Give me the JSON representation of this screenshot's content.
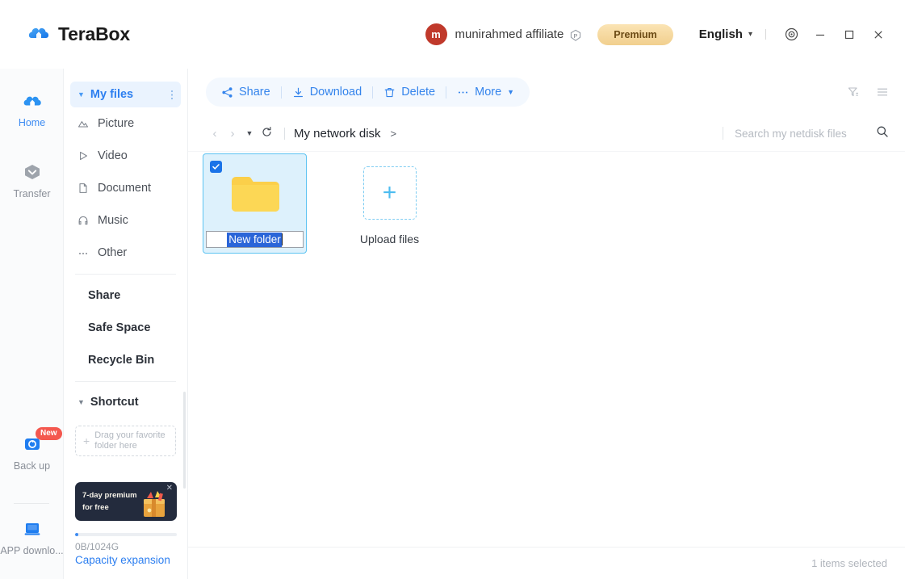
{
  "app": {
    "brand": "TeraBox",
    "brand_icon": "terabox-cloud-logo",
    "accent_color": "#2d7ff0",
    "selection_color": "#1a73e8",
    "folder_color": "#fbcf4a"
  },
  "titlebar": {
    "avatar_initial": "m",
    "user_name": "munirahmed affiliate",
    "user_badge_icon": "p-diamond-icon",
    "premium_label": "Premium",
    "language_label": "English",
    "language_caret_icon": "chevron-down-icon",
    "settings_icon": "target-settings-icon",
    "minimize_label": "—",
    "maximize_label": "☐",
    "close_label": "×"
  },
  "rail": {
    "items": [
      {
        "label": "Home",
        "icon": "cloud-icon",
        "active": true,
        "badge": ""
      },
      {
        "label": "Transfer",
        "icon": "transfer-hexagon-icon",
        "active": false,
        "badge": ""
      },
      {
        "label": "Back up",
        "icon": "backup-sync-icon",
        "active": false,
        "badge": "New"
      },
      {
        "label": "APP downlo...",
        "icon": "app-download-icon",
        "active": false,
        "badge": ""
      }
    ]
  },
  "sidebar": {
    "header": {
      "label": "My files",
      "expand_icon": "triangle-down-icon",
      "menu_icon": "kebab-menu-icon"
    },
    "items": [
      {
        "label": "Picture",
        "icon": "picture-icon",
        "bold": false
      },
      {
        "label": "Video",
        "icon": "video-play-icon",
        "bold": false
      },
      {
        "label": "Document",
        "icon": "document-icon",
        "bold": false
      },
      {
        "label": "Music",
        "icon": "music-headphone-icon",
        "bold": false
      },
      {
        "label": "Other",
        "icon": "ellipsis-icon",
        "bold": false
      }
    ],
    "items2": [
      {
        "label": "Share",
        "icon": "",
        "bold": true
      },
      {
        "label": "Safe Space",
        "icon": "",
        "bold": true
      },
      {
        "label": "Recycle Bin",
        "icon": "",
        "bold": true
      }
    ],
    "shortcut": {
      "label": "Shortcut",
      "expand_icon": "triangle-down-icon"
    },
    "dropzone": {
      "line1": "Drag your favorite",
      "line2": "folder here",
      "plus_icon": "plus-icon"
    },
    "promo": {
      "line1": "7-day premium",
      "line2": "for free",
      "close_icon": "close-icon",
      "art_icon": "gift-box-icon"
    },
    "capacity": {
      "value": "0B/1024G",
      "link": "Capacity expansion",
      "percent": 0
    }
  },
  "toolbar": {
    "buttons": [
      {
        "label": "Share",
        "icon": "share-nodes-icon"
      },
      {
        "label": "Download",
        "icon": "download-icon"
      },
      {
        "label": "Delete",
        "icon": "trash-icon"
      },
      {
        "label": "More",
        "icon": "ellipsis-icon",
        "caret": "▼"
      }
    ],
    "filter_icon": "filter-icon",
    "list-view_icon": "list-view-icon"
  },
  "breadcrumb": {
    "back_icon": "chevron-left-icon",
    "forward_icon": "chevron-right-icon",
    "history_caret_icon": "triangle-down-icon",
    "refresh_icon": "refresh-icon",
    "path": "My network disk",
    "path_separator": ">"
  },
  "search": {
    "placeholder": "Search my netdisk files",
    "value": "",
    "icon": "search-icon"
  },
  "files": {
    "folder": {
      "name_value": "New folder",
      "name_selected": true,
      "selected": true,
      "icon": "folder-icon",
      "checkbox_icon": "checkmark-icon"
    },
    "upload": {
      "label": "Upload files",
      "icon": "plus-icon"
    }
  },
  "status": {
    "text": "1 items selected"
  }
}
